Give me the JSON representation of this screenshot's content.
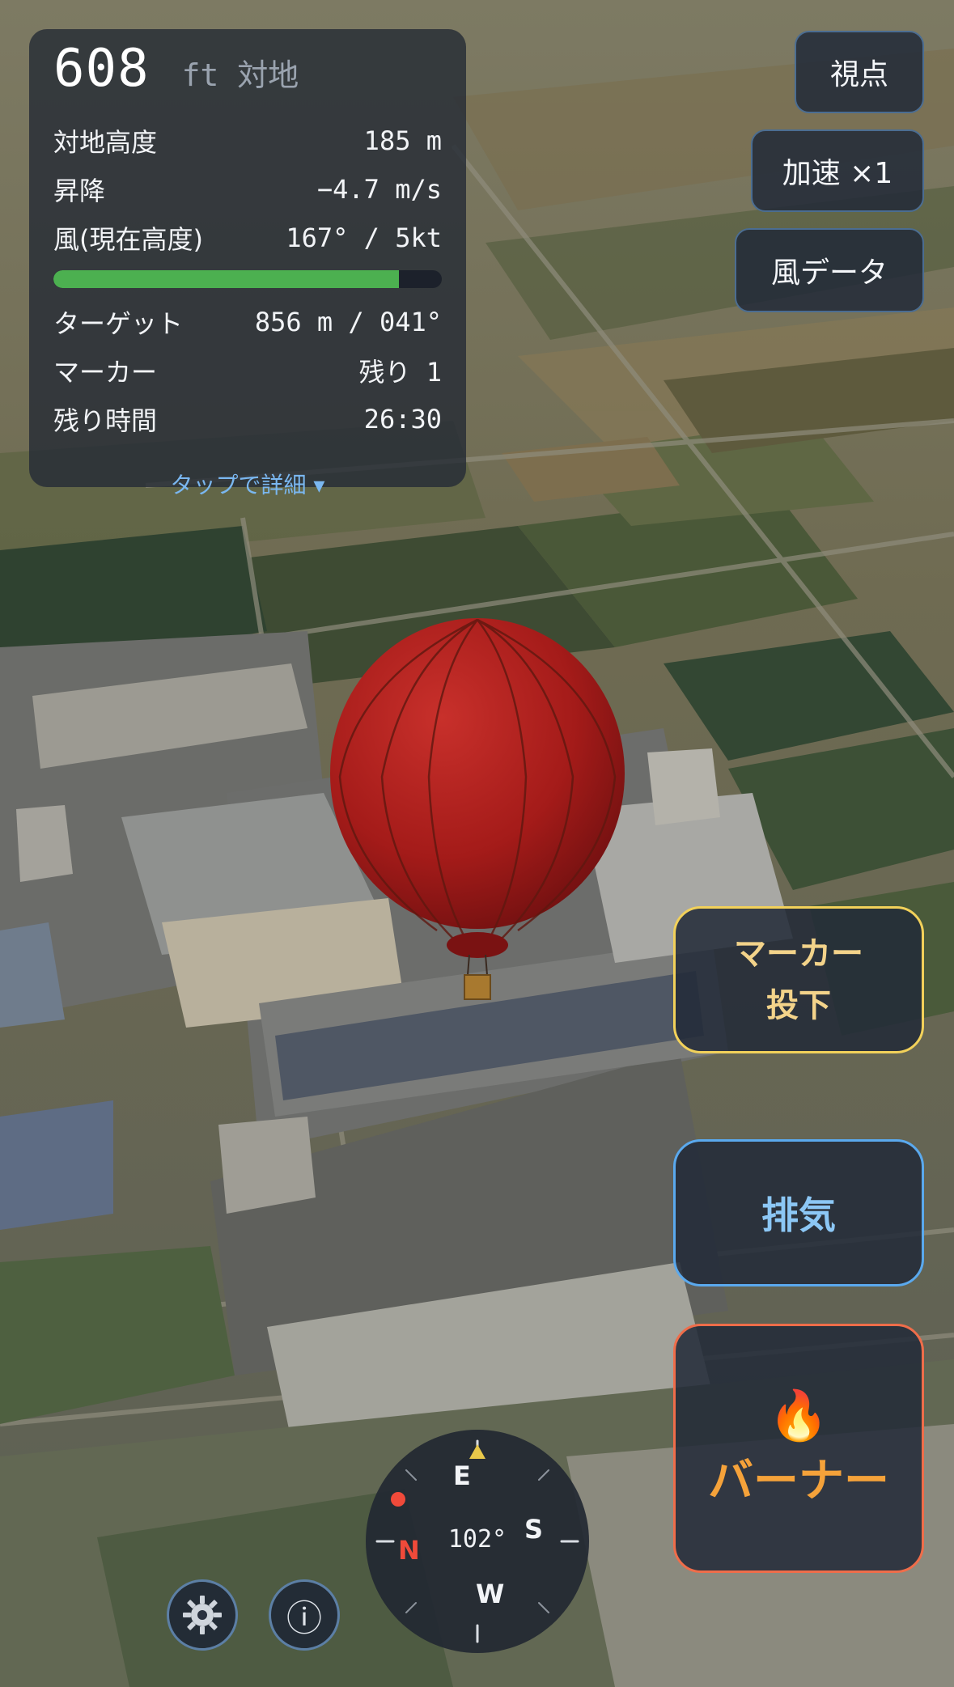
{
  "hud": {
    "altitude_value": "608",
    "altitude_unit": "ft 対地",
    "rows": [
      {
        "label": "対地高度",
        "value": "185 m"
      },
      {
        "label": "昇降",
        "value": "−4.7 m/s"
      },
      {
        "label": "風(現在高度)",
        "value": "167° / 5kt"
      }
    ],
    "fuel_level": 0.89,
    "rows2": [
      {
        "label": "ターゲット",
        "value": "856 m / 041°"
      },
      {
        "label": "マーカー",
        "value": "残り 1"
      },
      {
        "label": "残り時間",
        "value": "26:30"
      }
    ],
    "details_toggle": "タップで詳細 ▾"
  },
  "top_buttons": {
    "viewpoint": "視点",
    "speed": "加速 ×1",
    "wind_data": "風データ"
  },
  "actions": {
    "marker_drop_line1": "マーカー",
    "marker_drop_line2": "投下",
    "vent": "排気",
    "burner_icon": "🔥",
    "burner": "バーナー"
  },
  "icons": {
    "settings": "gear-icon",
    "info": "info-icon",
    "info_glyph": "ⓘ"
  },
  "compass": {
    "heading": "102°",
    "north": "N",
    "east": "E",
    "south": "S",
    "west": "W"
  },
  "colors": {
    "fuel_bar": "#4cb050",
    "marker_border": "#f2d15a",
    "vent_border": "#5aa9ee",
    "burner_border": "#ef6d4a",
    "balloon": "#b3201e",
    "north_marker": "#f04a3a",
    "heading_marker": "#e8c84a"
  }
}
